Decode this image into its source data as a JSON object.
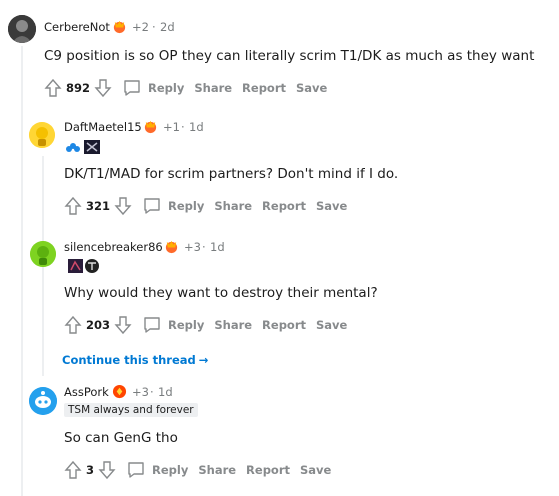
{
  "comments": [
    {
      "username": "CerbereNot",
      "award_count": "+2",
      "sep": "·",
      "age": "2d",
      "body": "C9 position is so OP they can literally scrim T1/DK as much as they want",
      "score": "892",
      "actions": [
        "Reply",
        "Share",
        "Report",
        "Save"
      ]
    },
    {
      "username": "DaftMaetel15",
      "award_count": "+1",
      "sep": "·",
      "age": "1d",
      "body": "DK/T1/MAD for scrim partners? Don't mind if I do.",
      "score": "321",
      "actions": [
        "Reply",
        "Share",
        "Report",
        "Save"
      ]
    },
    {
      "username": "silencebreaker86",
      "award_count": "+3",
      "sep": "·",
      "age": "1d",
      "body": "Why would they want to destroy their mental?",
      "score": "203",
      "actions": [
        "Reply",
        "Share",
        "Report",
        "Save"
      ]
    },
    {
      "username": "AssPork",
      "award_count": "+3",
      "sep": "·",
      "age": "1d",
      "flair": "TSM always and forever",
      "body": "So can GenG tho",
      "score": "3",
      "actions": [
        "Reply",
        "Share",
        "Report",
        "Save"
      ]
    }
  ],
  "continue_thread": {
    "label": "Continue this thread",
    "arrow": "→"
  },
  "colors": {
    "link_blue": "#0079d3",
    "meta_gray": "#787c7e",
    "action_gray": "#878a8c",
    "thread_line": "#edeff1"
  }
}
